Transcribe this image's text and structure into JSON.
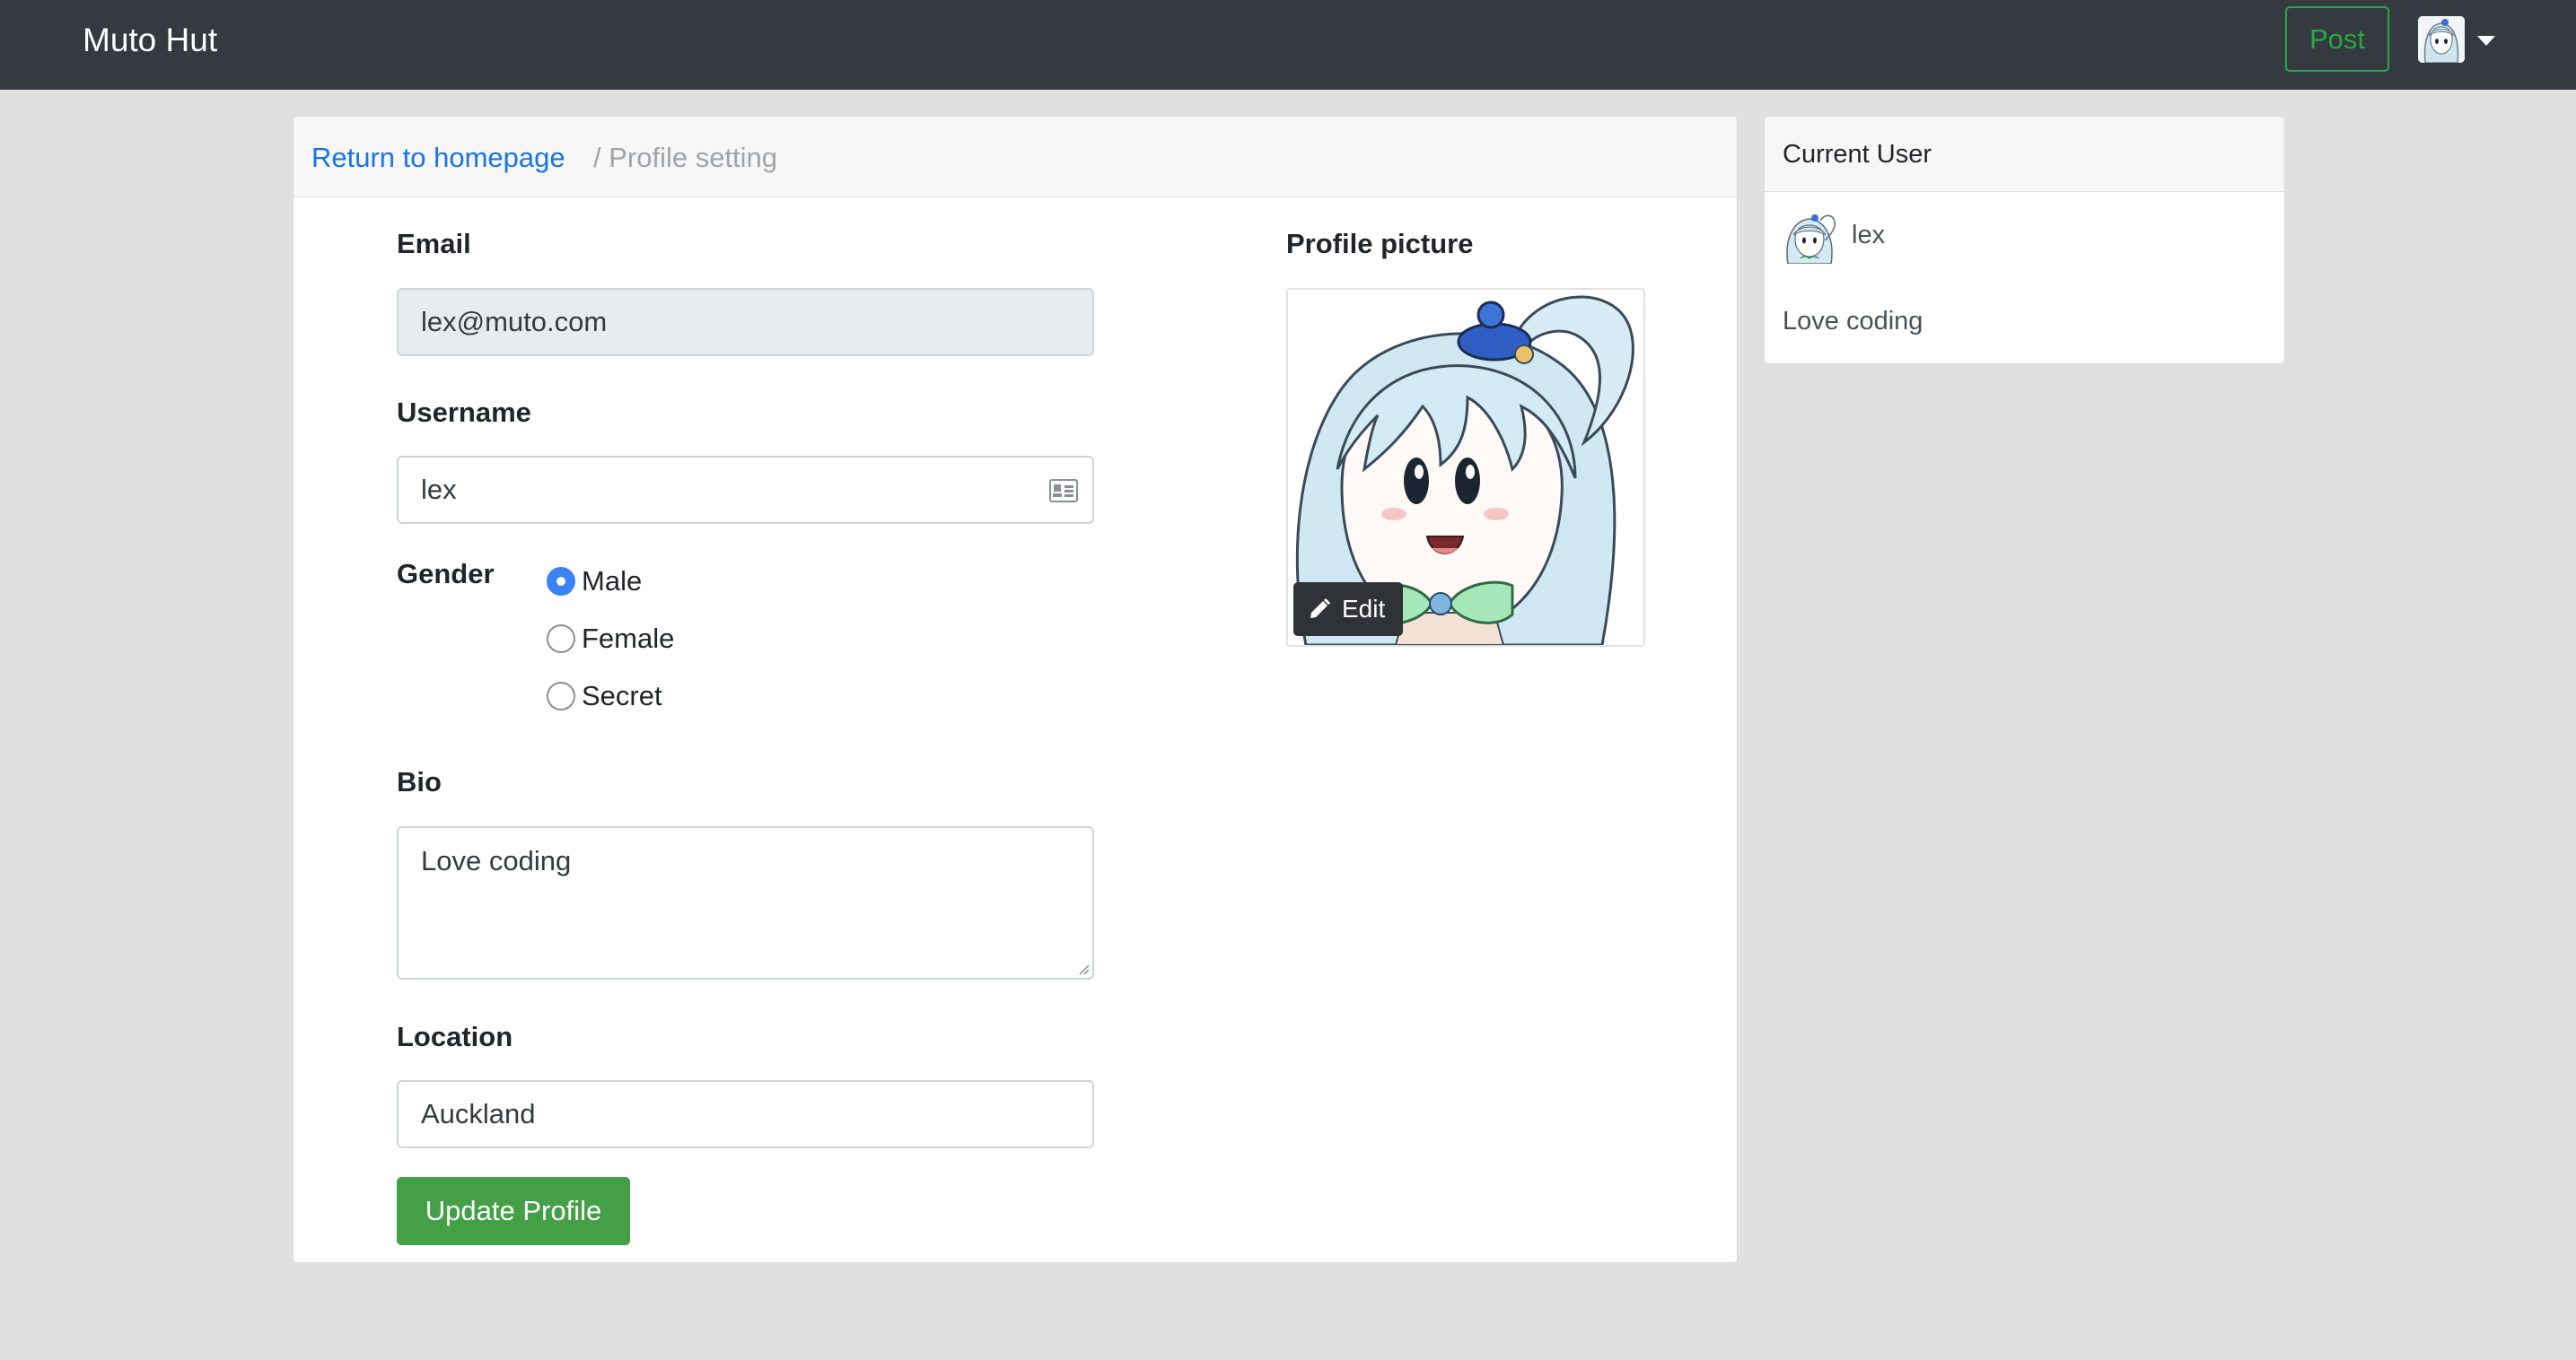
{
  "navbar": {
    "brand": "Muto Hut",
    "post_label": "Post"
  },
  "breadcrumb": {
    "home_link": "Return to homepage",
    "current": "/ Profile setting"
  },
  "form": {
    "email_label": "Email",
    "email_value": "lex@muto.com",
    "username_label": "Username",
    "username_value": "lex",
    "gender_label": "Gender",
    "gender_options": [
      "Male",
      "Female",
      "Secret"
    ],
    "gender_selected": "Male",
    "bio_label": "Bio",
    "bio_value": "Love coding",
    "location_label": "Location",
    "location_value": "Auckland",
    "submit_label": "Update Profile"
  },
  "profile_picture": {
    "label": "Profile picture",
    "edit_label": "Edit"
  },
  "current_user": {
    "title": "Current User",
    "username": "lex",
    "bio": "Love coding"
  },
  "colors": {
    "navbar": "#343a40",
    "accent_green": "#28a745",
    "link_blue": "#1a73e8",
    "radio_blue": "#3b82f6"
  },
  "icons": [
    "id-card-icon",
    "pencil-icon",
    "caret-down-icon",
    "avatar"
  ]
}
